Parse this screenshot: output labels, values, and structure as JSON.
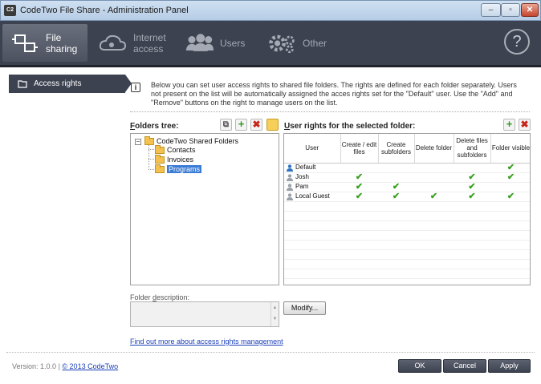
{
  "window": {
    "title": "CodeTwo File Share - Administration Panel",
    "app_icon_text": "C2",
    "minimize_glyph": "‒",
    "maximize_glyph": "▫",
    "close_glyph": "✕"
  },
  "nav": {
    "tabs": [
      {
        "label_line1": "File",
        "label_line2": "sharing",
        "icon": "file-sharing-icon",
        "active": true
      },
      {
        "label_line1": "Internet",
        "label_line2": "access",
        "icon": "cloud-icon",
        "active": false
      },
      {
        "label_line1": "Users",
        "label_line2": "",
        "icon": "users-icon",
        "active": false
      },
      {
        "label_line1": "Other",
        "label_line2": "",
        "icon": "gears-icon",
        "active": false
      }
    ],
    "help_glyph": "?"
  },
  "sidebar": {
    "items": [
      {
        "label": "Access rights",
        "icon": "access-rights-icon"
      }
    ]
  },
  "intro": {
    "info_glyph": "i",
    "text": "Below you can set user access rights to shared file folders. The rights are defined for each folder separately. Users not present on the list will be automatically assigned the acces rights set for the \"Default\" user. Use the \"Add\" and \"Remove\" buttons on the right to manage users on the list."
  },
  "folders": {
    "title_prefix": "F",
    "title_rest": "olders tree:",
    "toolbar": {
      "copy_glyph": "⧉",
      "add_glyph": "+",
      "remove_glyph": "✖"
    },
    "tree": {
      "expander": "−",
      "root": "CodeTwo Shared Folders",
      "children": [
        "Contacts",
        "Invoices",
        "Programs"
      ],
      "selected": "Programs"
    }
  },
  "rights": {
    "title_prefix": "U",
    "title_rest": "ser rights for the selected folder:",
    "toolbar": {
      "add_glyph": "+",
      "remove_glyph": "✖"
    },
    "columns": [
      "User",
      "Create / edit files",
      "Create subfolders",
      "Delete folder",
      "Delete files and subfolders",
      "Folder visible"
    ],
    "check_glyph": "✔",
    "rows": [
      {
        "user": "Default",
        "icon": "default-user-icon",
        "checks": [
          false,
          false,
          false,
          false,
          true
        ]
      },
      {
        "user": "Josh",
        "icon": "user-icon",
        "checks": [
          true,
          false,
          false,
          true,
          true
        ]
      },
      {
        "user": "Pam",
        "icon": "user-icon",
        "checks": [
          true,
          true,
          false,
          true,
          false
        ]
      },
      {
        "user": "Local Guest",
        "icon": "user-icon",
        "checks": [
          true,
          true,
          true,
          true,
          true
        ]
      }
    ]
  },
  "description": {
    "label_pre": "Folder ",
    "label_u": "d",
    "label_post": "escription:",
    "value": "",
    "scroll_up": "▲",
    "scroll_down": "▼",
    "modify_label": "Modify..."
  },
  "links": {
    "learn_more": "Find out more about access rights management"
  },
  "footer": {
    "version": "Version: 1.0.0",
    "separator": "|",
    "copyright": "© 2013 CodeTwo",
    "ok": "OK",
    "cancel": "Cancel",
    "apply": "Apply"
  },
  "colors": {
    "nav_bg": "#3d4250",
    "check": "#3aa020",
    "remove": "#c9241c",
    "link": "#1a3fb8",
    "selection": "#3a7bd5"
  }
}
